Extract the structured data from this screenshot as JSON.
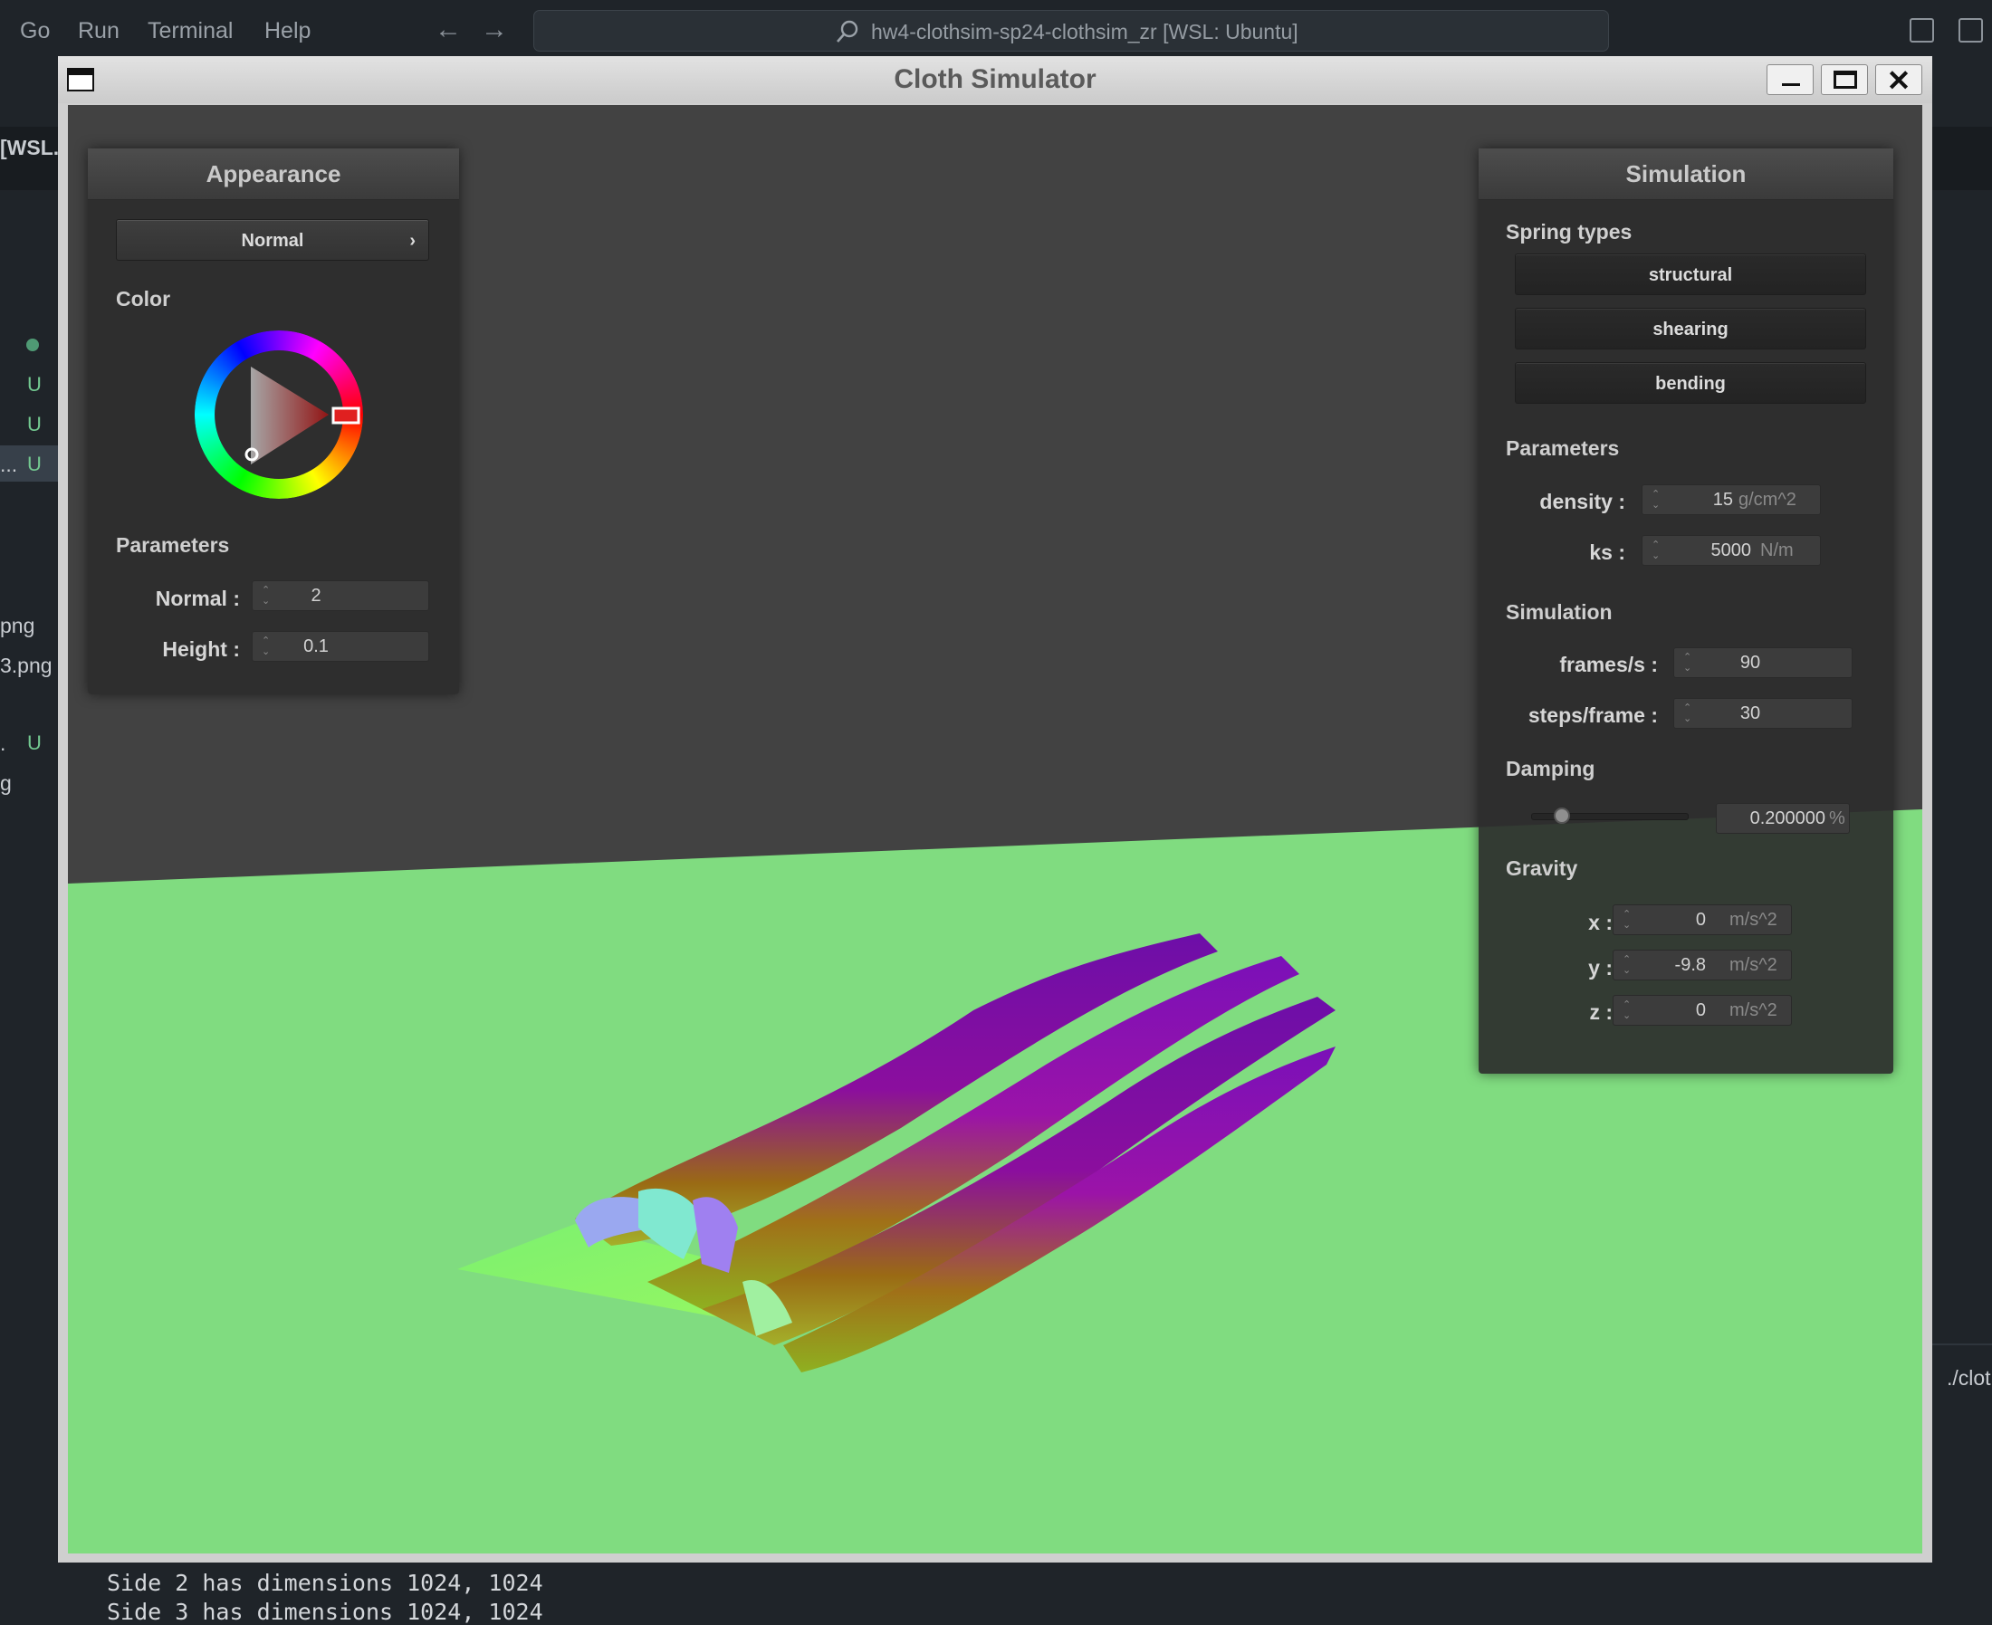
{
  "vscode": {
    "menu": [
      "Go",
      "Run",
      "Terminal",
      "Help"
    ],
    "command_center": "hw4-clothsim-sp24-clothsim_zr [WSL: Ubuntu]",
    "explorer": {
      "remote_label": "[WSL...",
      "badge_u": "U",
      "file_1": "png",
      "file_2": "3.png",
      "file_3": ".",
      "file_4": "g",
      "truncated": "..."
    },
    "terminal": {
      "path": "./clot",
      "lines": [
        "Side 2 has dimensions 1024, 1024",
        "Side 3 has dimensions 1024, 1024"
      ]
    }
  },
  "window": {
    "title": "Cloth Simulator",
    "close_symbol": "✕"
  },
  "appearance": {
    "title": "Appearance",
    "shader": "Normal",
    "shader_chevron": "›",
    "color_label": "Color",
    "color_value": "#e02020",
    "parameters_label": "Parameters",
    "normal_label": "Normal :",
    "normal_value": "2",
    "height_label": "Height :",
    "height_value": "0.1"
  },
  "simulation": {
    "title": "Simulation",
    "spring_types_label": "Spring types",
    "springs": [
      "structural",
      "shearing",
      "bending"
    ],
    "parameters_label": "Parameters",
    "density_label": "density :",
    "density_value": "15",
    "density_unit": "g/cm^2",
    "ks_label": "ks :",
    "ks_value": "5000",
    "ks_unit": "N/m",
    "simulation_label": "Simulation",
    "fps_label": "frames/s :",
    "fps_value": "90",
    "steps_label": "steps/frame :",
    "steps_value": "30",
    "damping_label": "Damping",
    "damping_value": "0.200000",
    "damping_unit": "%",
    "damping_fraction": 0.2,
    "gravity_label": "Gravity",
    "gx_label": "x :",
    "gx_value": "0",
    "gy_label": "y :",
    "gy_value": "-9.8",
    "gz_label": "z :",
    "gz_value": "0",
    "gravity_unit": "m/s^2"
  },
  "colors": {
    "floor": "#80dc80",
    "background": "#424242",
    "cloth_purple": "#8a10b0",
    "cloth_yellow": "#9aa020"
  }
}
